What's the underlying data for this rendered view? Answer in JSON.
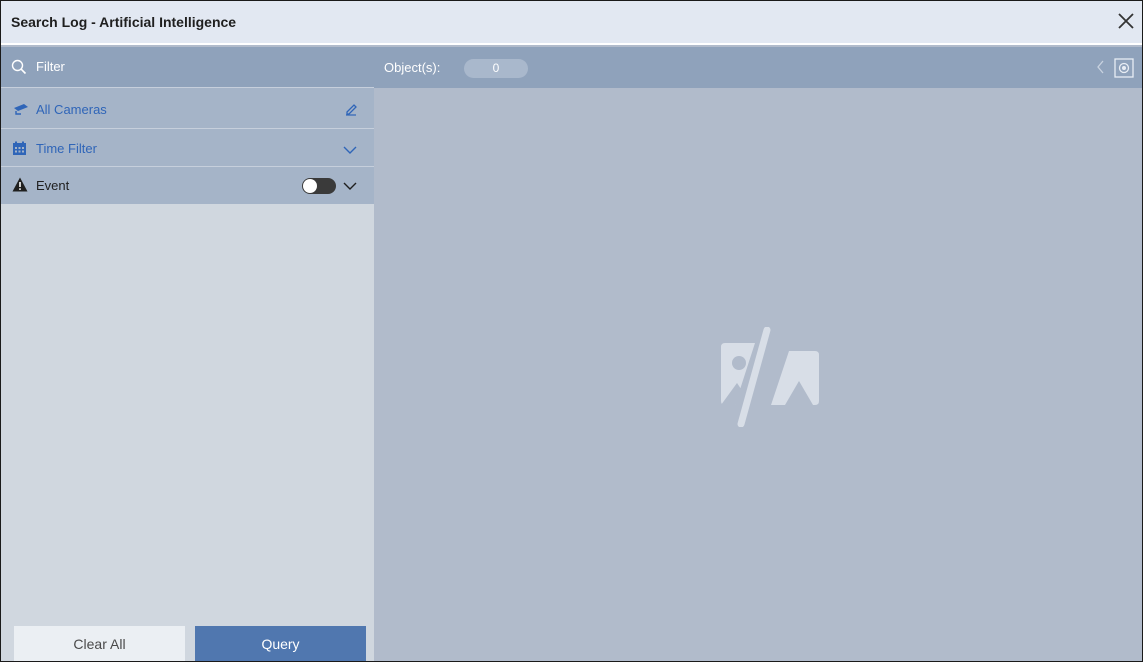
{
  "window": {
    "title": "Search Log - Artificial Intelligence",
    "close_icon": "close-icon"
  },
  "filter": {
    "label": "Filter",
    "icon": "search-icon"
  },
  "rows": {
    "cameras": {
      "label": "All Cameras",
      "icon": "camera-icon",
      "action_icon": "edit-pencil-icon"
    },
    "time": {
      "label": "Time Filter",
      "icon": "calendar-icon",
      "action_icon": "chevron-down-icon"
    },
    "event": {
      "label": "Event",
      "icon": "warning-icon",
      "toggle_on": false,
      "action_icon": "chevron-down-icon"
    }
  },
  "buttons": {
    "clear_all": "Clear All",
    "query": "Query"
  },
  "results": {
    "objects_label": "Object(s):",
    "objects_count": "0",
    "empty_icon": "no-image-icon"
  },
  "colors": {
    "accent": "#5077af",
    "link": "#2f65b8",
    "header": "#8fa2bb",
    "panel": "#d0d7df",
    "content": "#b1bbcb"
  }
}
